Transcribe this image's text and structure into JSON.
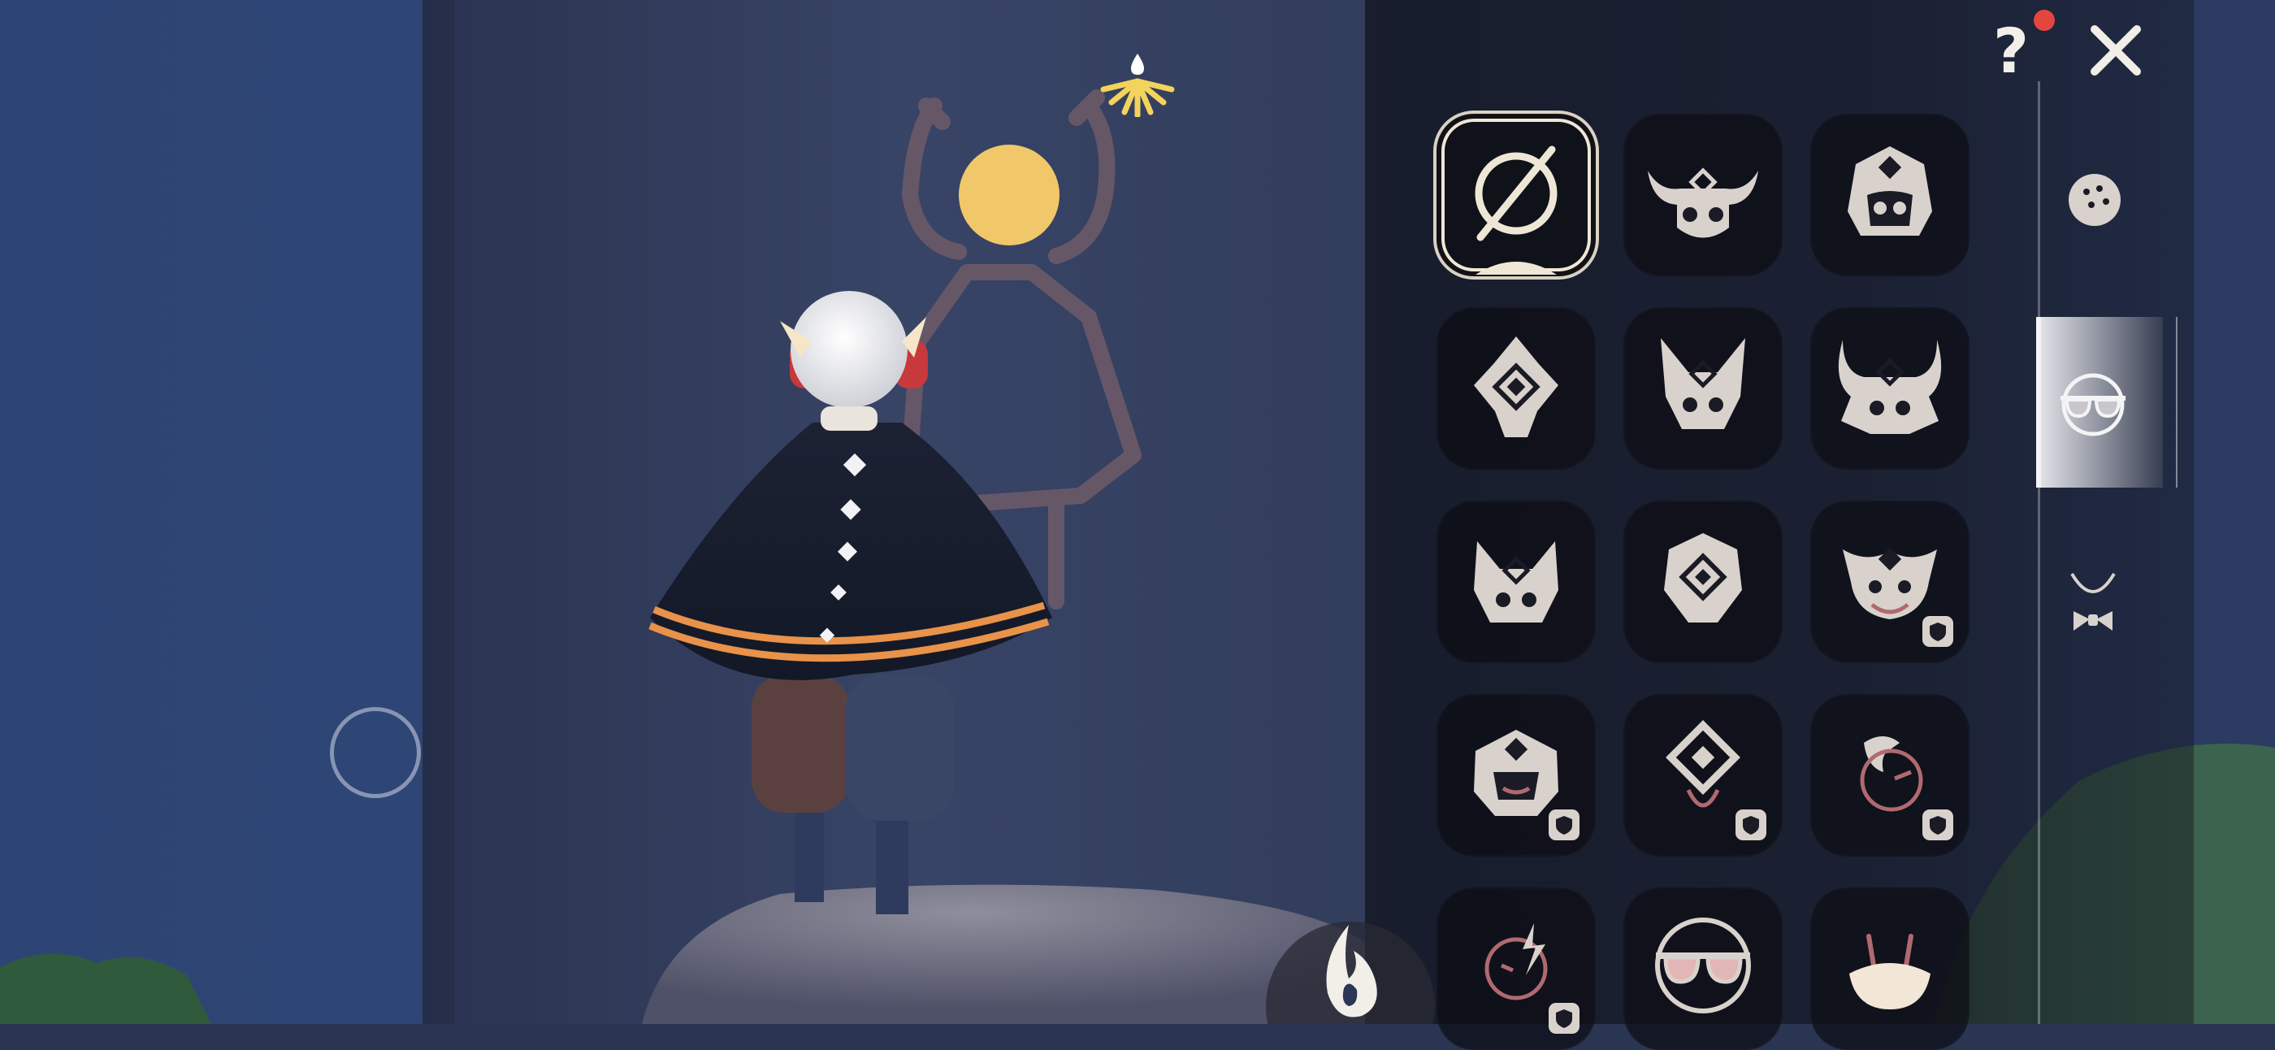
{
  "hud": {
    "help_label": "?",
    "help_notification": true,
    "close_icon": "close-x-icon",
    "cape_energy_icon": "cape-winged-light-fan-icon",
    "joystick_icon": "movement-joystick-ring",
    "emote_icon": "candle-flame-icon"
  },
  "closet": {
    "selected_index": 0,
    "slots": [
      {
        "id": "none",
        "icon": "none-empty-slot-icon",
        "locked": false
      },
      {
        "id": "mask-horned-bull",
        "icon": "horned-mask-icon",
        "locked": false
      },
      {
        "id": "mask-helmet-gem",
        "icon": "helmet-mask-icon",
        "locked": false
      },
      {
        "id": "mask-diamond-totem",
        "icon": "diamond-totem-mask-icon",
        "locked": false
      },
      {
        "id": "mask-tall-ears",
        "icon": "tall-ears-mask-icon",
        "locked": false
      },
      {
        "id": "mask-curved-horns",
        "icon": "curved-horns-mask-icon",
        "locked": false
      },
      {
        "id": "mask-fox",
        "icon": "fox-mask-icon",
        "locked": false
      },
      {
        "id": "mask-shield-gem",
        "icon": "shield-gem-mask-icon",
        "locked": false
      },
      {
        "id": "mask-crown-smile",
        "icon": "crown-smile-mask-icon",
        "locked": true
      },
      {
        "id": "mask-armored",
        "icon": "armored-mask-icon",
        "locked": true
      },
      {
        "id": "mask-diamond-face",
        "icon": "diamond-face-mask-icon",
        "locked": true
      },
      {
        "id": "mask-wink-flame",
        "icon": "wink-flame-mask-icon",
        "locked": true
      },
      {
        "id": "mask-wink-bolt",
        "icon": "wink-bolt-mask-icon",
        "locked": true
      },
      {
        "id": "mask-sunglasses",
        "icon": "sunglasses-mask-icon",
        "locked": false
      },
      {
        "id": "mask-bunny-face",
        "icon": "bunny-face-mask-icon",
        "locked": false
      }
    ]
  },
  "categories": [
    {
      "id": "hair",
      "icon": "hair-bun-icon",
      "active": false
    },
    {
      "id": "mask",
      "icon": "sunglasses-mask-tab-icon",
      "active": true
    },
    {
      "id": "necklace",
      "icon": "necklace-bowtie-icon",
      "active": false
    }
  ],
  "colors": {
    "panel_bg": "#12141e",
    "icon_light": "#d9d2cc",
    "icon_accent": "#b06a6f",
    "selected_ring": "#efe7d6",
    "notification": "#e5453f",
    "cape_energy": "#f3d35a"
  }
}
